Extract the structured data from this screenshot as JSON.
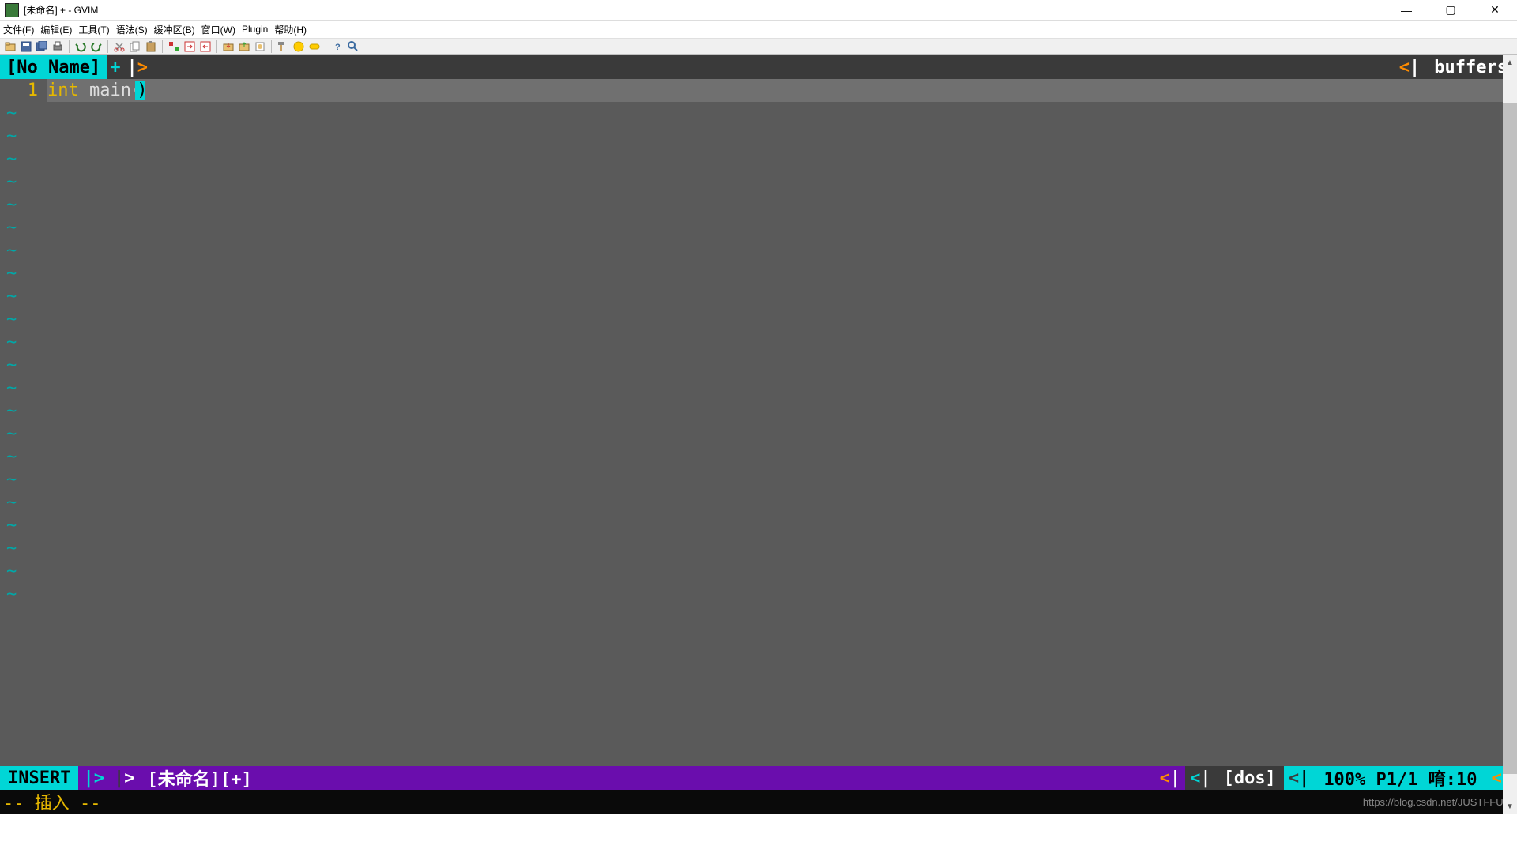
{
  "window": {
    "title": "[未命名] + - GVIM"
  },
  "menubar": {
    "file": "文件(F)",
    "edit": "编辑(E)",
    "tools": "工具(T)",
    "syntax": "语法(S)",
    "buffers": "缓冲区(B)",
    "window": "窗口(W)",
    "plugin": "Plugin",
    "help": "帮助(H)"
  },
  "tabline": {
    "active_tab": "[No Name]",
    "plus": "+",
    "arrow_pipe": "|",
    "arrow_gt": ">",
    "arrow_lt": "<",
    "buffers_label": "buffers"
  },
  "editor": {
    "line_number": "1",
    "code_keyword": "int",
    "code_func": "main",
    "code_paren_open": "(",
    "code_paren_close": ")",
    "tilde": "~"
  },
  "statusline": {
    "mode": "INSERT",
    "sep_gt": ">",
    "sep_pipe": "|",
    "sep_lt": "<",
    "filename": "[未命名][+]",
    "filetype": "[dos]",
    "position": "100% P1/1 唷:10"
  },
  "cmdline": {
    "mode_text": "-- 插入 --",
    "watermark": "https://blog.csdn.net/JUSTFFUN"
  }
}
